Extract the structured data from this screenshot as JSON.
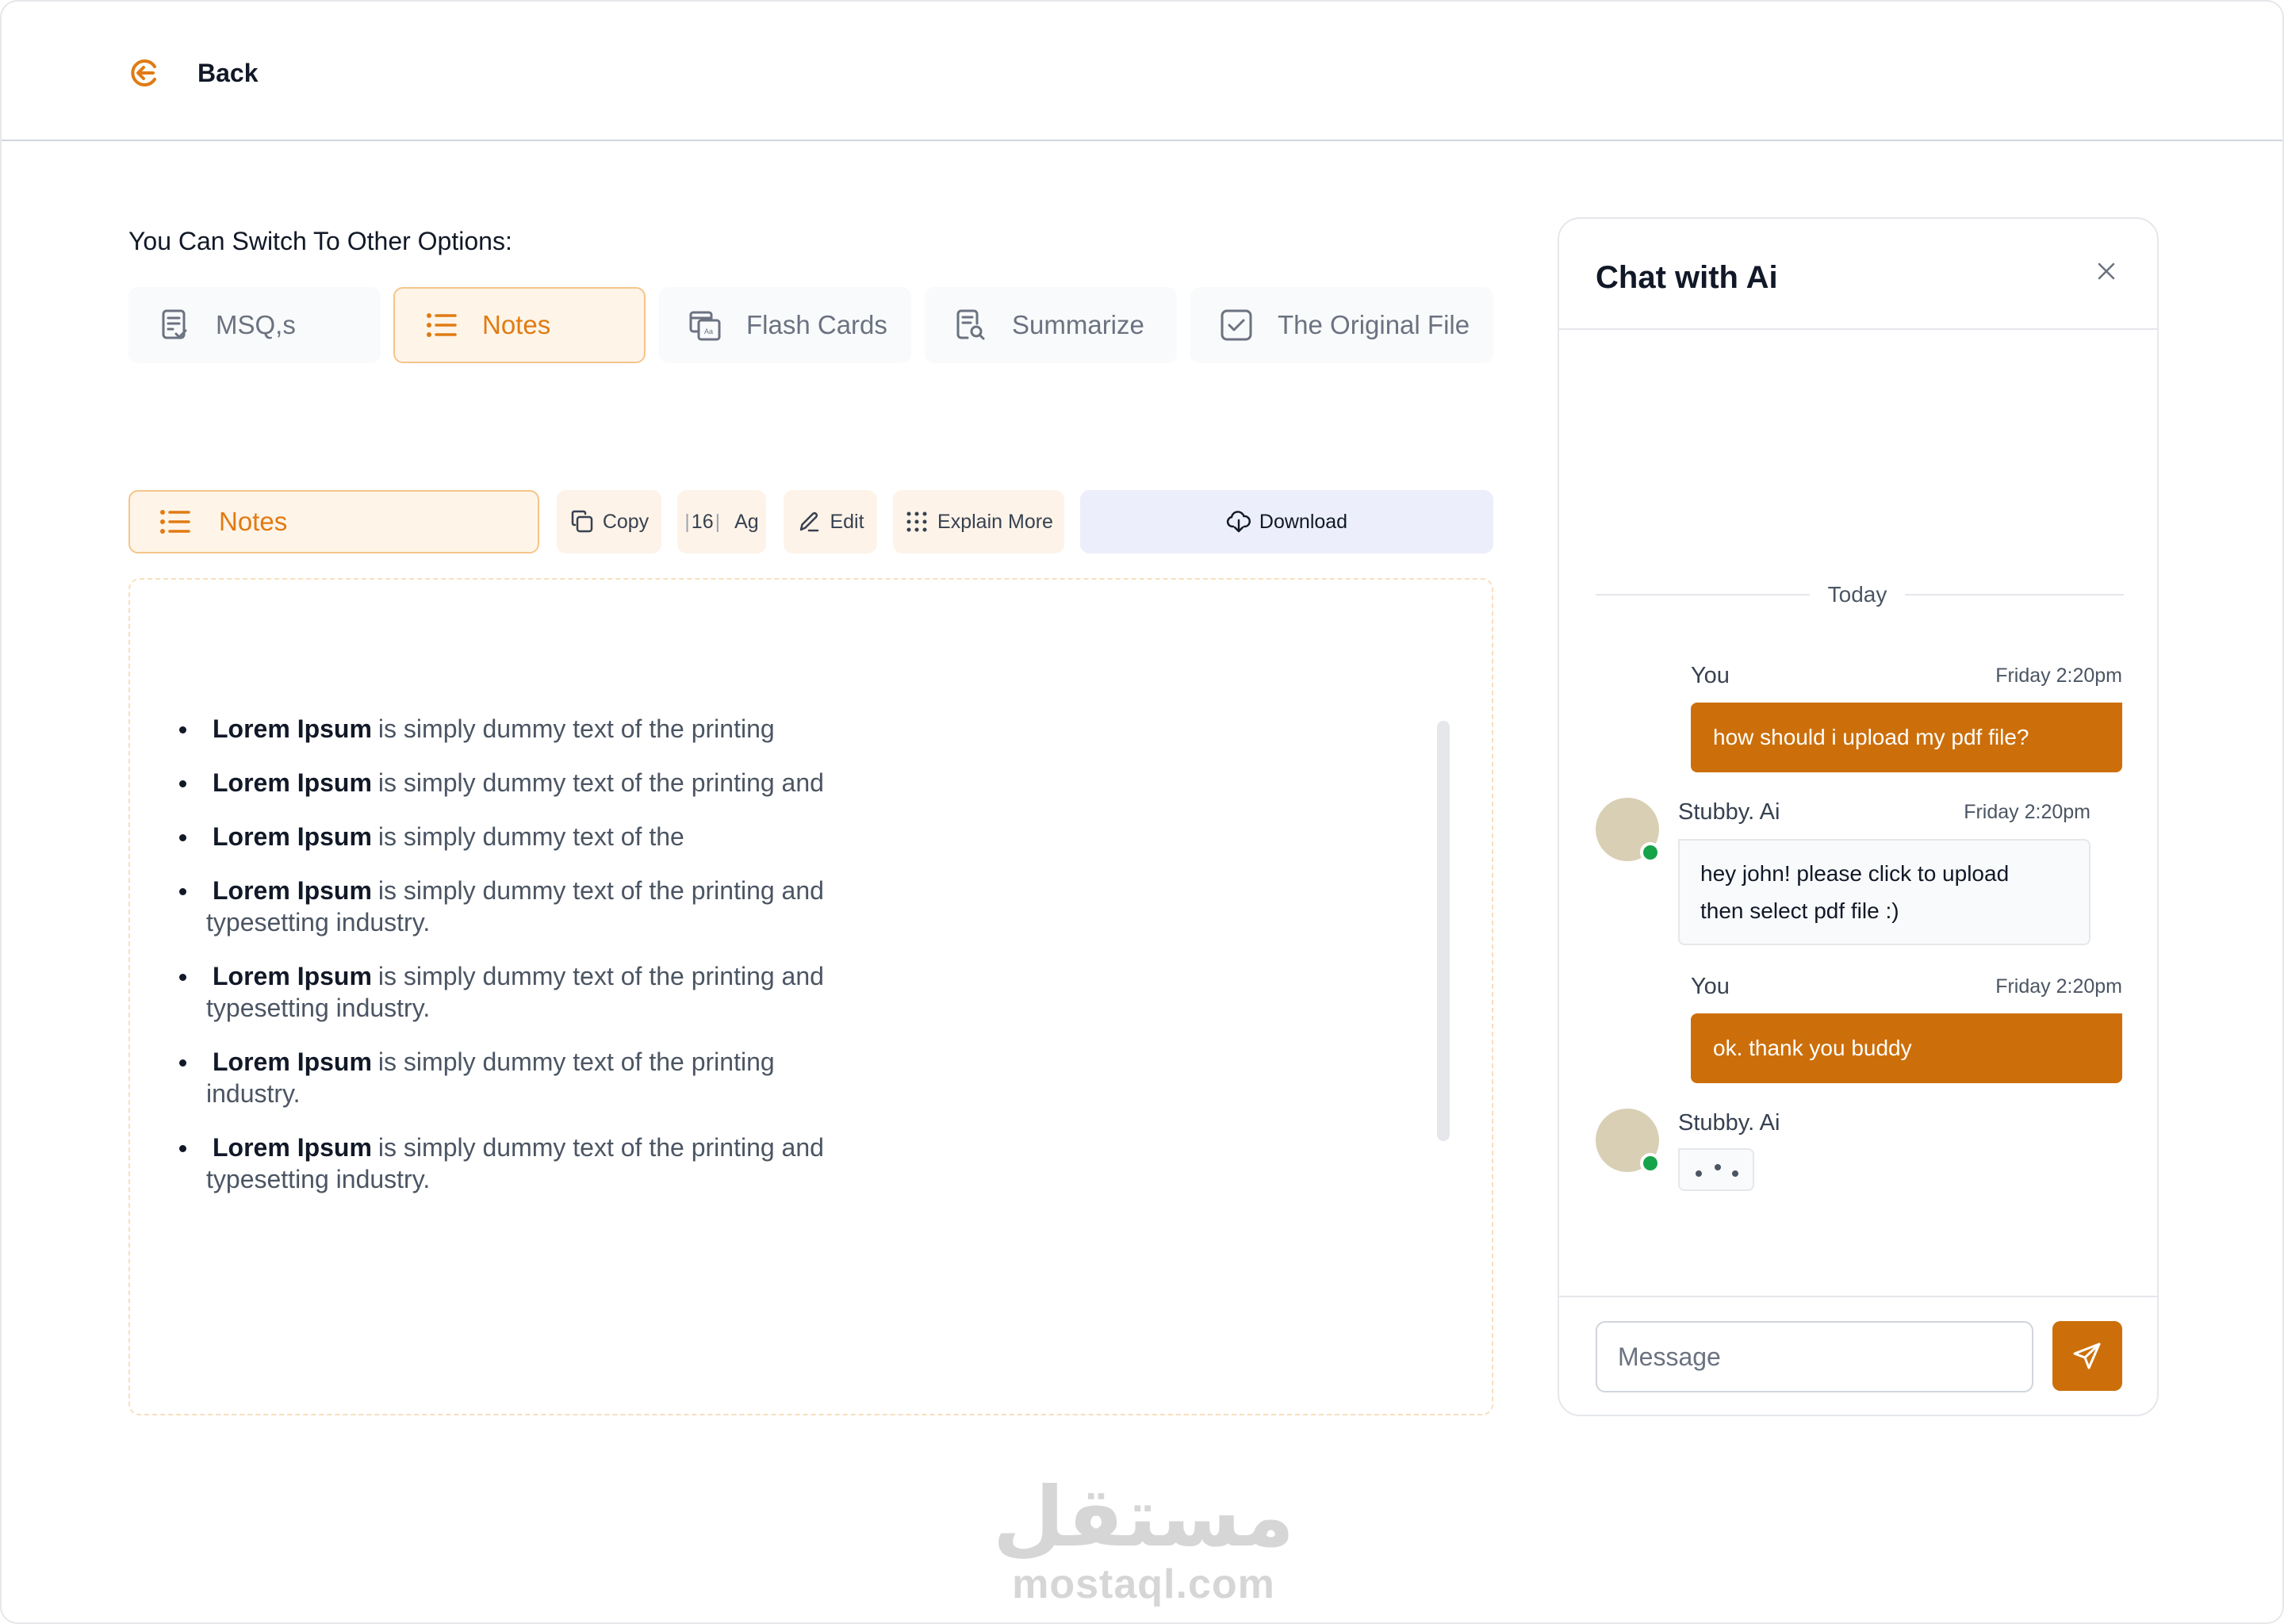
{
  "header": {
    "back_label": "Back"
  },
  "switcher": {
    "title": "You Can Switch To Other Options:",
    "options": [
      {
        "label": "MSQ,s",
        "icon": "checklist-icon",
        "active": false
      },
      {
        "label": "Notes",
        "icon": "list-icon",
        "active": true
      },
      {
        "label": "Flash Cards",
        "icon": "flash-cards-icon",
        "active": false
      },
      {
        "label": "Summarize",
        "icon": "document-search-icon",
        "active": false
      },
      {
        "label": "The Original File",
        "icon": "checkbox-icon",
        "active": false
      }
    ]
  },
  "toolbar": {
    "notes_label": "Notes",
    "copy_label": "Copy",
    "font_size": "16",
    "font_label": "Ag",
    "edit_label": "Edit",
    "explain_label": "Explain More",
    "download_label": "Download"
  },
  "notes": {
    "items": [
      {
        "bold": "Lorem Ipsum",
        "line1": "is simply dummy text of the printing",
        "line2": ""
      },
      {
        "bold": "Lorem Ipsum",
        "line1": "is simply dummy text of the printing and",
        "line2": ""
      },
      {
        "bold": "Lorem Ipsum",
        "line1": "is simply dummy text of the",
        "line2": ""
      },
      {
        "bold": "Lorem Ipsum",
        "line1": "is simply dummy text of the printing and",
        "line2": "typesetting industry."
      },
      {
        "bold": "Lorem Ipsum",
        "line1": "is simply dummy text of the printing and",
        "line2": "typesetting industry."
      },
      {
        "bold": "Lorem Ipsum",
        "line1": "is simply dummy text of the printing",
        "line2": "industry."
      },
      {
        "bold": "Lorem Ipsum",
        "line1": "is simply dummy text of the printing and",
        "line2": "typesetting industry."
      }
    ]
  },
  "chat": {
    "title": "Chat with Ai",
    "divider_label": "Today",
    "messages": [
      {
        "sender": "You",
        "time": "Friday 2:20pm",
        "text": "how should i upload my pdf file?"
      },
      {
        "sender": "Stubby. Ai",
        "time": "Friday 2:20pm",
        "text_line1": "hey john! please click to upload",
        "text_line2": "then select pdf file :)"
      },
      {
        "sender": "You",
        "time": "Friday 2:20pm",
        "text": "ok. thank you buddy"
      },
      {
        "sender": "Stubby. Ai",
        "typing": true
      }
    ],
    "input_placeholder": "Message"
  },
  "watermark": {
    "arabic": "مستقل",
    "latin": "mostaql.com"
  },
  "colors": {
    "accent": "#cc6f0a",
    "accent_light": "#fff4e8",
    "accent_border": "#f4c58a",
    "online": "#16a34a",
    "download_bg": "#eceefb"
  }
}
